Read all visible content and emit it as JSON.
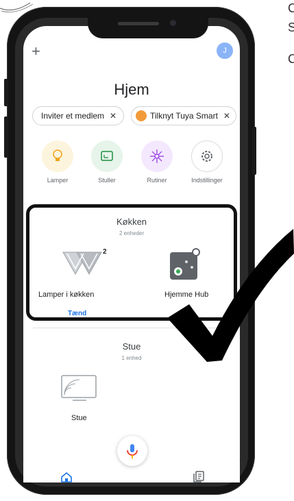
{
  "header": {
    "add_label": "+",
    "avatar_label": "J",
    "title": "Hjem"
  },
  "chips": [
    {
      "label": "Inviter et medlem",
      "close": "✕"
    },
    {
      "label": "Tilknyt Tuya Smart",
      "close": "✕"
    }
  ],
  "quick_actions": [
    {
      "label": "Lamper",
      "icon": "bulb-icon",
      "color": "#fcf4dc"
    },
    {
      "label": "Stuller",
      "icon": "cast-icon",
      "color": "#e6f4ea"
    },
    {
      "label": "Rutiner",
      "icon": "sparkle-icon",
      "color": "#f3e8fd"
    },
    {
      "label": "Indstillinger",
      "icon": "gear-icon",
      "color": "#ffffff"
    }
  ],
  "rooms": [
    {
      "name": "Køkken",
      "subtitle": "2 enheder",
      "devices": [
        {
          "label": "Lamper i køkken",
          "badge": "2",
          "status": "Tænd"
        },
        {
          "label": "Hjemme Hub",
          "badge": ""
        }
      ]
    },
    {
      "name": "Stue",
      "subtitle": "1 enhed",
      "devices": [
        {
          "label": "Stue"
        }
      ]
    }
  ],
  "edge_text": [
    "C",
    "S",
    "C"
  ],
  "colors": {
    "accent": "#1a73e8",
    "avatar": "#8ab4f8",
    "mic_blue": "#4285f4",
    "mic_red": "#ea4335",
    "mic_yellow": "#fbbc04"
  }
}
